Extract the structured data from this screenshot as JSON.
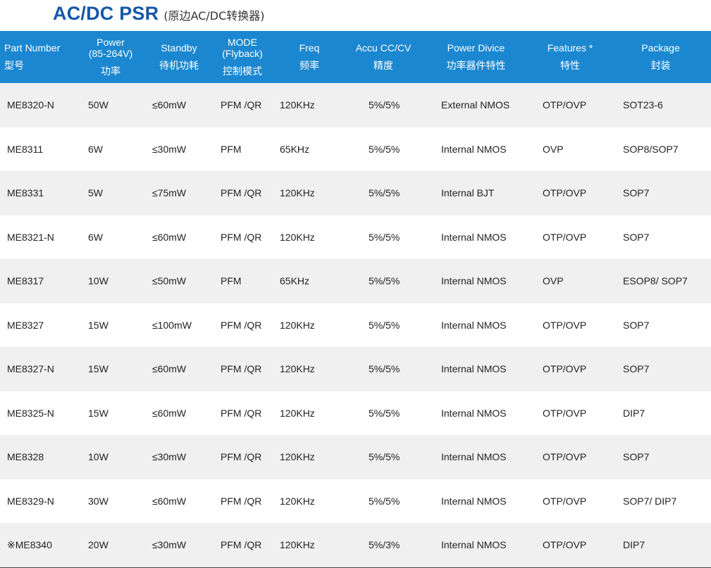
{
  "title": {
    "main": "AC/DC PSR",
    "sub": "(原边AC/DC转换器)"
  },
  "columns": [
    {
      "en": "Part Number",
      "cn": "型号"
    },
    {
      "en": "Power\n(85-264V)",
      "cn": "功率"
    },
    {
      "en": "Standby",
      "cn": "待机功耗"
    },
    {
      "en": "MODE\n(Flyback)",
      "cn": "控制模式"
    },
    {
      "en": "Freq",
      "cn": "频率"
    },
    {
      "en": "Accu CC/CV",
      "cn": "精度"
    },
    {
      "en": "Power Divice",
      "cn": "功率器件特性"
    },
    {
      "en": "Features *",
      "cn": "特性"
    },
    {
      "en": "Package",
      "cn": "封装"
    }
  ],
  "rows": [
    [
      "ME8320-N",
      "50W",
      "≤60mW",
      "PFM /QR",
      "120KHz",
      "5%/5%",
      "External NMOS",
      "OTP/OVP",
      "SOT23-6"
    ],
    [
      "ME8311",
      "6W",
      "≤30mW",
      "PFM",
      "65KHz",
      "5%/5%",
      "Internal NMOS",
      "OVP",
      "SOP8/SOP7"
    ],
    [
      "ME8331",
      "5W",
      "≤75mW",
      "PFM /QR",
      "120KHz",
      "5%/5%",
      "Internal BJT",
      "OTP/OVP",
      "SOP7"
    ],
    [
      "ME8321-N",
      "6W",
      "≤60mW",
      "PFM /QR",
      "120KHz",
      "5%/5%",
      "Internal NMOS",
      "OTP/OVP",
      "SOP7"
    ],
    [
      "ME8317",
      "10W",
      "≤50mW",
      "PFM",
      "65KHz",
      "5%/5%",
      "Internal NMOS",
      "OVP",
      "ESOP8/ SOP7"
    ],
    [
      "ME8327",
      "15W",
      "≤100mW",
      "PFM /QR",
      "120KHz",
      "5%/5%",
      "Internal NMOS",
      "OTP/OVP",
      "SOP7"
    ],
    [
      "ME8327-N",
      "15W",
      "≤60mW",
      "PFM /QR",
      "120KHz",
      "5%/5%",
      "Internal NMOS",
      "OTP/OVP",
      "SOP7"
    ],
    [
      "ME8325-N",
      "15W",
      "≤60mW",
      "PFM /QR",
      "120KHz",
      "5%/5%",
      "Internal NMOS",
      "OTP/OVP",
      "DIP7"
    ],
    [
      "ME8328",
      "10W",
      "≤30mW",
      "PFM /QR",
      "120KHz",
      "5%/5%",
      "Internal NMOS",
      "OTP/OVP",
      "SOP7"
    ],
    [
      "ME8329-N",
      "30W",
      "≤60mW",
      "PFM /QR",
      "120KHz",
      "5%/5%",
      "Internal NMOS",
      "OTP/OVP",
      "SOP7/ DIP7"
    ],
    [
      "※ME8340",
      "20W",
      "≤30mW",
      "PFM /QR",
      "120KHz",
      "5%/3%",
      "Internal NMOS",
      "OTP/OVP",
      "DIP7"
    ]
  ],
  "colors": {
    "title": "#1558a8",
    "header_bg": "#1b87d0",
    "stripe": "#f0f0f0"
  }
}
